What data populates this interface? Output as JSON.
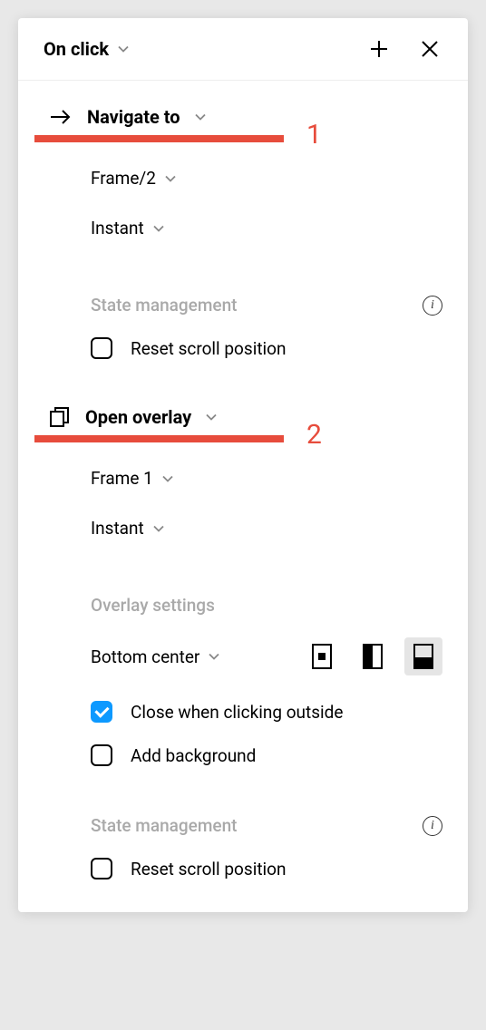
{
  "header": {
    "trigger_label": "On click"
  },
  "actions": [
    {
      "type_label": "Navigate to",
      "annotation": "1",
      "destination": "Frame/2",
      "animation": "Instant",
      "state_label": "State management",
      "reset_scroll_label": "Reset scroll position",
      "reset_scroll_checked": false
    },
    {
      "type_label": "Open overlay",
      "annotation": "2",
      "destination": "Frame 1",
      "animation": "Instant",
      "overlay_settings_label": "Overlay settings",
      "position": "Bottom center",
      "close_outside_label": "Close when clicking outside",
      "close_outside_checked": true,
      "add_bg_label": "Add background",
      "add_bg_checked": false,
      "state_label": "State management",
      "reset_scroll_label": "Reset scroll position",
      "reset_scroll_checked": false
    }
  ]
}
